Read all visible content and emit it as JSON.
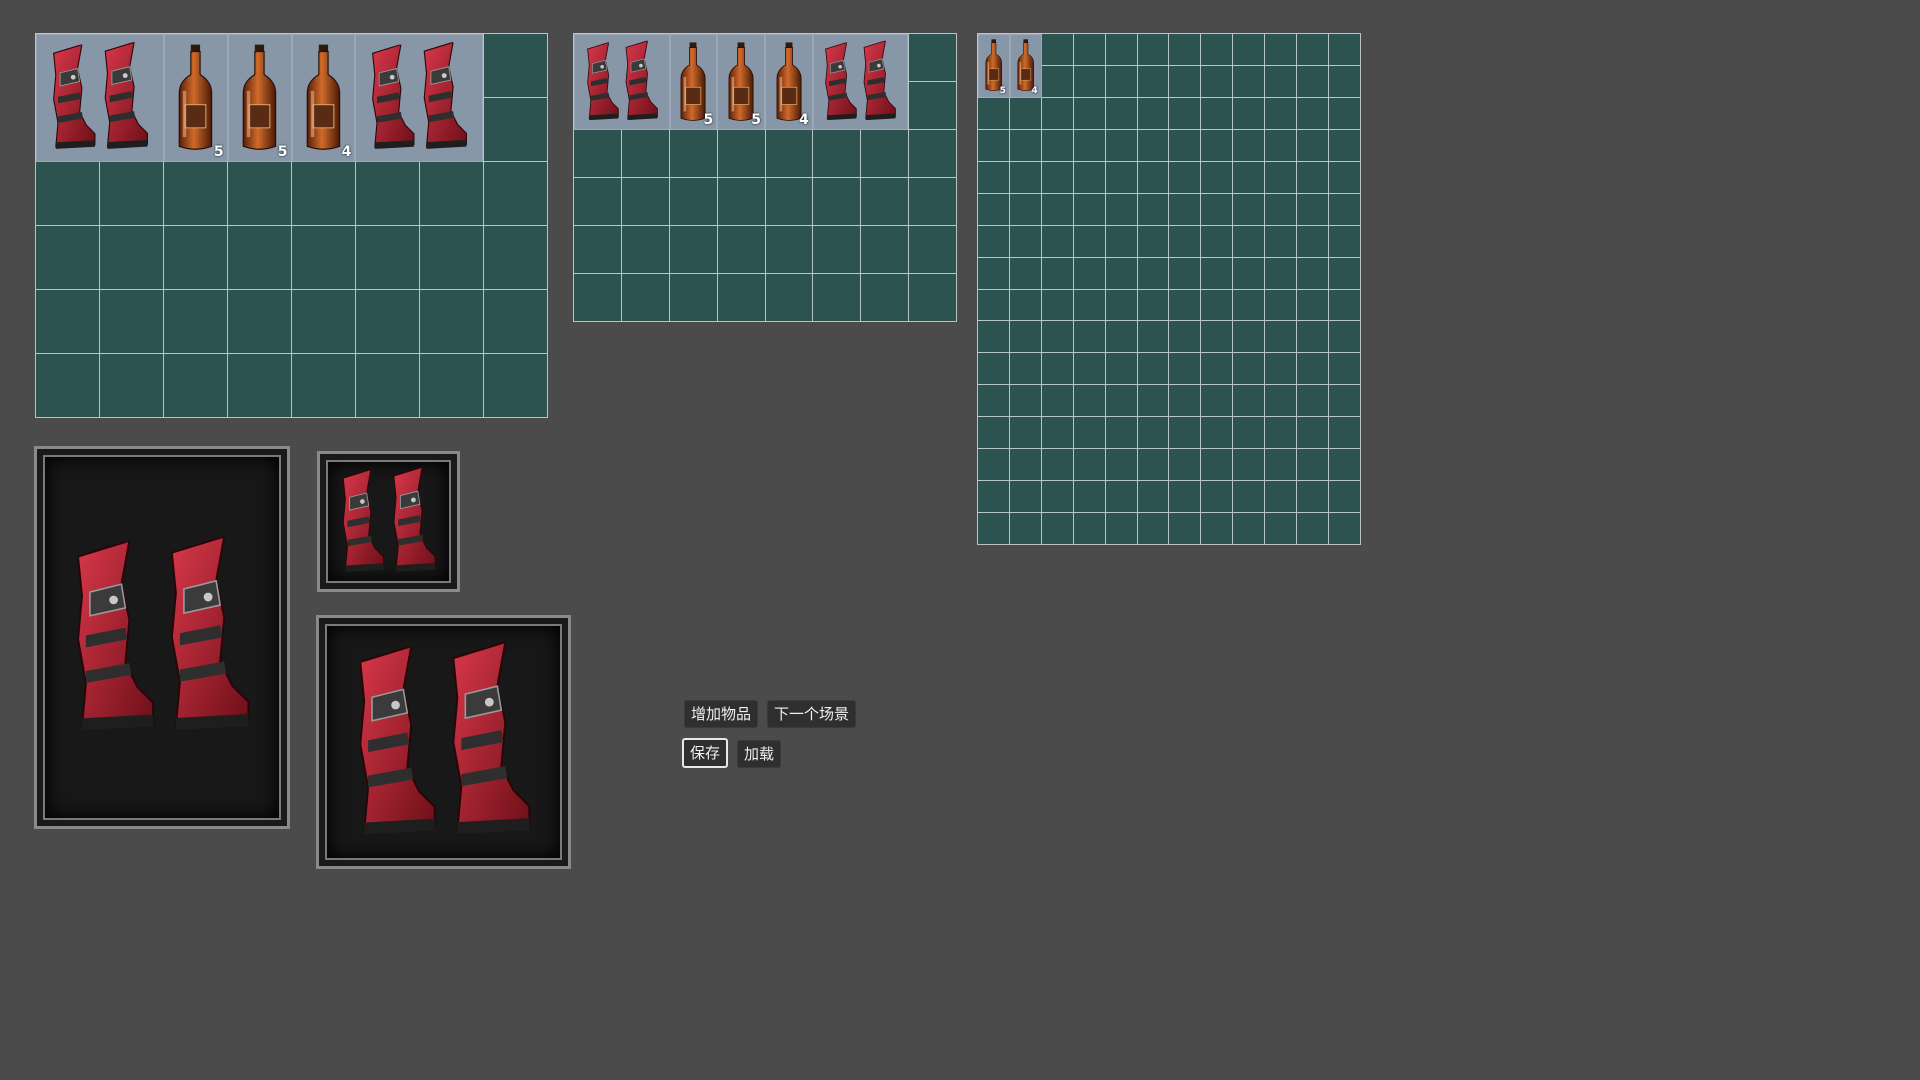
{
  "colors": {
    "background": "#4b4b4b",
    "slot_empty": "#2c5350",
    "slot_border": "#b9c3c8",
    "slot_occupied": "#8797a8",
    "boot_red": "#b11d2a",
    "bottle_amber": "#b3511a"
  },
  "inventories": [
    {
      "name": "inventory-large",
      "columns": 8,
      "rows": 6,
      "items": [
        {
          "type": "boots-icon",
          "col": 0,
          "row": 0,
          "w": 2,
          "h": 2,
          "count": ""
        },
        {
          "type": "potion-bottle-icon",
          "col": 2,
          "row": 0,
          "w": 1,
          "h": 2,
          "count": "5"
        },
        {
          "type": "potion-bottle-icon",
          "col": 3,
          "row": 0,
          "w": 1,
          "h": 2,
          "count": "5"
        },
        {
          "type": "potion-bottle-icon",
          "col": 4,
          "row": 0,
          "w": 1,
          "h": 2,
          "count": "4"
        },
        {
          "type": "boots-icon",
          "col": 5,
          "row": 0,
          "w": 2,
          "h": 2,
          "count": ""
        }
      ]
    },
    {
      "name": "inventory-medium",
      "columns": 8,
      "rows": 6,
      "items": [
        {
          "type": "boots-icon",
          "col": 0,
          "row": 0,
          "w": 2,
          "h": 2,
          "count": ""
        },
        {
          "type": "potion-bottle-icon",
          "col": 2,
          "row": 0,
          "w": 1,
          "h": 2,
          "count": "5"
        },
        {
          "type": "potion-bottle-icon",
          "col": 3,
          "row": 0,
          "w": 1,
          "h": 2,
          "count": "5"
        },
        {
          "type": "potion-bottle-icon",
          "col": 4,
          "row": 0,
          "w": 1,
          "h": 2,
          "count": "4"
        },
        {
          "type": "boots-icon",
          "col": 5,
          "row": 0,
          "w": 2,
          "h": 2,
          "count": ""
        }
      ]
    },
    {
      "name": "inventory-small",
      "columns": 12,
      "rows": 16,
      "items": [
        {
          "type": "potion-bottle-icon",
          "col": 0,
          "row": 0,
          "w": 1,
          "h": 2,
          "count": "5"
        },
        {
          "type": "potion-bottle-icon",
          "col": 1,
          "row": 0,
          "w": 1,
          "h": 2,
          "count": "4"
        }
      ]
    }
  ],
  "equipment_slots": [
    {
      "name": "equip-slot-large",
      "item": "boots-icon"
    },
    {
      "name": "equip-slot-small",
      "item": "boots-icon"
    },
    {
      "name": "equip-slot-medium",
      "item": "boots-icon"
    }
  ],
  "buttons": {
    "add_item": "增加物品",
    "next_scene": "下一个场景",
    "save": "保存",
    "load": "加载"
  }
}
